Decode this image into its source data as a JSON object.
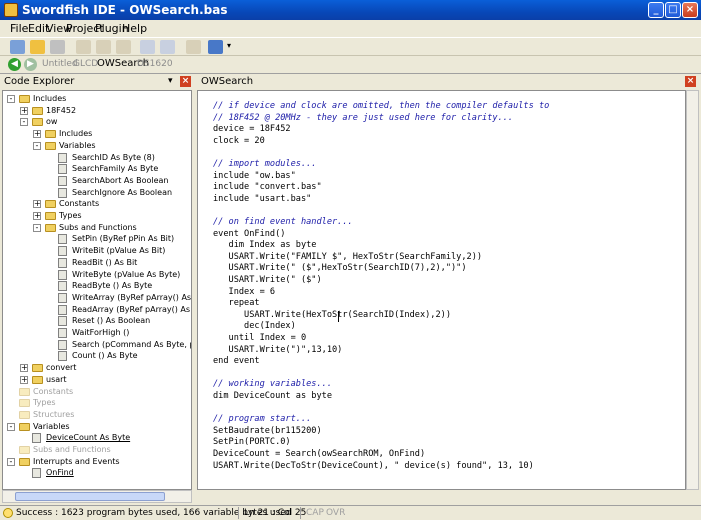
{
  "window": {
    "title": "Swordfish IDE - OWSearch.bas"
  },
  "menu": [
    "File",
    "Edit",
    "View",
    "Project",
    "Plugin",
    "Help"
  ],
  "docs": [
    "Untitled",
    "GLCD",
    "OWSearch",
    "DS1620"
  ],
  "left_panel": {
    "title": "Code Explorer"
  },
  "tree": [
    {
      "label": "Includes",
      "level": 0,
      "expander": "-",
      "icon": "folder",
      "style": "normal"
    },
    {
      "label": "18F452",
      "level": 1,
      "expander": "+",
      "icon": "folder",
      "style": "normal"
    },
    {
      "label": "ow",
      "level": 1,
      "expander": "-",
      "icon": "folder",
      "style": "normal"
    },
    {
      "label": "Includes",
      "level": 2,
      "expander": "+",
      "icon": "folder",
      "style": "normal"
    },
    {
      "label": "Variables",
      "level": 2,
      "expander": "-",
      "icon": "folder",
      "style": "normal"
    },
    {
      "label": "SearchID As Byte (8)",
      "level": 3,
      "expander": "",
      "icon": "proc",
      "style": "normal"
    },
    {
      "label": "SearchFamily As Byte",
      "level": 3,
      "expander": "",
      "icon": "proc",
      "style": "normal"
    },
    {
      "label": "SearchAbort As Boolean",
      "level": 3,
      "expander": "",
      "icon": "proc",
      "style": "normal"
    },
    {
      "label": "SearchIgnore As Boolean",
      "level": 3,
      "expander": "",
      "icon": "proc",
      "style": "normal"
    },
    {
      "label": "Constants",
      "level": 2,
      "expander": "+",
      "icon": "folder",
      "style": "normal"
    },
    {
      "label": "Types",
      "level": 2,
      "expander": "+",
      "icon": "folder",
      "style": "normal"
    },
    {
      "label": "Subs and Functions",
      "level": 2,
      "expander": "-",
      "icon": "folder",
      "style": "normal"
    },
    {
      "label": "SetPin (ByRef pPin As Bit)",
      "level": 3,
      "expander": "",
      "icon": "proc",
      "style": "normal"
    },
    {
      "label": "WriteBit (pValue As Bit)",
      "level": 3,
      "expander": "",
      "icon": "proc",
      "style": "normal"
    },
    {
      "label": "ReadBit () As Bit",
      "level": 3,
      "expander": "",
      "icon": "proc",
      "style": "normal"
    },
    {
      "label": "WriteByte (pValue As Byte)",
      "level": 3,
      "expander": "",
      "icon": "proc",
      "style": "normal"
    },
    {
      "label": "ReadByte () As Byte",
      "level": 3,
      "expander": "",
      "icon": "proc",
      "style": "normal"
    },
    {
      "label": "WriteArray (ByRef pArray() As Byte, pMa",
      "level": 3,
      "expander": "",
      "icon": "proc",
      "style": "normal"
    },
    {
      "label": "ReadArray (ByRef pArray() As Byte, pMa",
      "level": 3,
      "expander": "",
      "icon": "proc",
      "style": "normal"
    },
    {
      "label": "Reset () As Boolean",
      "level": 3,
      "expander": "",
      "icon": "proc",
      "style": "normal"
    },
    {
      "label": "WaitForHigh ()",
      "level": 3,
      "expander": "",
      "icon": "proc",
      "style": "normal"
    },
    {
      "label": "Search (pCommand As Byte, pOnSearch",
      "level": 3,
      "expander": "",
      "icon": "proc",
      "style": "normal"
    },
    {
      "label": "Count () As Byte",
      "level": 3,
      "expander": "",
      "icon": "proc",
      "style": "normal"
    },
    {
      "label": "convert",
      "level": 1,
      "expander": "+",
      "icon": "folder",
      "style": "normal"
    },
    {
      "label": "usart",
      "level": 1,
      "expander": "+",
      "icon": "folder",
      "style": "normal"
    },
    {
      "label": "Constants",
      "level": 0,
      "expander": "",
      "icon": "folder",
      "style": "gray"
    },
    {
      "label": "Types",
      "level": 0,
      "expander": "",
      "icon": "folder",
      "style": "gray"
    },
    {
      "label": "Structures",
      "level": 0,
      "expander": "",
      "icon": "folder",
      "style": "gray"
    },
    {
      "label": "Variables",
      "level": 0,
      "expander": "-",
      "icon": "folder",
      "style": "normal"
    },
    {
      "label": "DeviceCount As Byte",
      "level": 1,
      "expander": "",
      "icon": "proc",
      "style": "link"
    },
    {
      "label": "Subs and Functions",
      "level": 0,
      "expander": "",
      "icon": "folder",
      "style": "gray"
    },
    {
      "label": "Interrupts and Events",
      "level": 0,
      "expander": "-",
      "icon": "folder",
      "style": "normal"
    },
    {
      "label": "OnFind",
      "level": 1,
      "expander": "",
      "icon": "proc",
      "style": "link"
    }
  ],
  "editor": {
    "tab": "OWSearch",
    "lines": [
      {
        "text": "// if device and clock are omitted, then the compiler defaults to",
        "kind": "comment"
      },
      {
        "text": "// 18F452 @ 20MHz - they are just used here for clarity...",
        "kind": "comment"
      },
      {
        "text": "device = 18F452",
        "kind": "normal"
      },
      {
        "text": "clock = 20",
        "kind": "normal"
      },
      {
        "text": "",
        "kind": "normal"
      },
      {
        "text": "// import modules...",
        "kind": "comment"
      },
      {
        "text": "include \"ow.bas\"",
        "kind": "normal"
      },
      {
        "text": "include \"convert.bas\"",
        "kind": "normal"
      },
      {
        "text": "include \"usart.bas\"",
        "kind": "normal"
      },
      {
        "text": "",
        "kind": "normal"
      },
      {
        "text": "// on find event handler...",
        "kind": "comment"
      },
      {
        "text": "event OnFind()",
        "kind": "normal"
      },
      {
        "text": "   dim Index as byte",
        "kind": "normal"
      },
      {
        "text": "   USART.Write(\"FAMILY $\", HexToStr(SearchFamily,2))",
        "kind": "normal"
      },
      {
        "text": "   USART.Write(\" ($\",HexToStr(SearchID(7),2),\")\")",
        "kind": "normal"
      },
      {
        "text": "   USART.Write(\" ($\")",
        "kind": "normal"
      },
      {
        "text": "   Index = 6",
        "kind": "normal"
      },
      {
        "text": "   repeat",
        "kind": "normal"
      },
      {
        "text": "      USART.Write(HexToStr(SearchID(Index),2))",
        "kind": "normal"
      },
      {
        "text": "      dec(Index)",
        "kind": "normal"
      },
      {
        "text": "   until Index = 0",
        "kind": "normal"
      },
      {
        "text": "   USART.Write(\")\",13,10)",
        "kind": "normal"
      },
      {
        "text": "end event",
        "kind": "normal"
      },
      {
        "text": "",
        "kind": "normal"
      },
      {
        "text": "// working variables...",
        "kind": "comment"
      },
      {
        "text": "dim DeviceCount as byte",
        "kind": "normal"
      },
      {
        "text": "",
        "kind": "normal"
      },
      {
        "text": "// program start...",
        "kind": "comment"
      },
      {
        "text": "SetBaudrate(br115200)",
        "kind": "normal"
      },
      {
        "text": "SetPin(PORTC.0)",
        "kind": "normal"
      },
      {
        "text": "DeviceCount = Search(owSearchROM, OnFind)",
        "kind": "normal"
      },
      {
        "text": "USART.Write(DecToStr(DeviceCount), \" device(s) found\", 13, 10)",
        "kind": "normal"
      }
    ]
  },
  "status": {
    "message": "Success : 1623 program bytes used, 166 variable bytes used",
    "position": "Ln 21 : Col 25",
    "caps": "CAP",
    "ovr": "OVR"
  },
  "colors": {
    "titlebar": "#0848b8",
    "comment": "#1c1ca8"
  }
}
